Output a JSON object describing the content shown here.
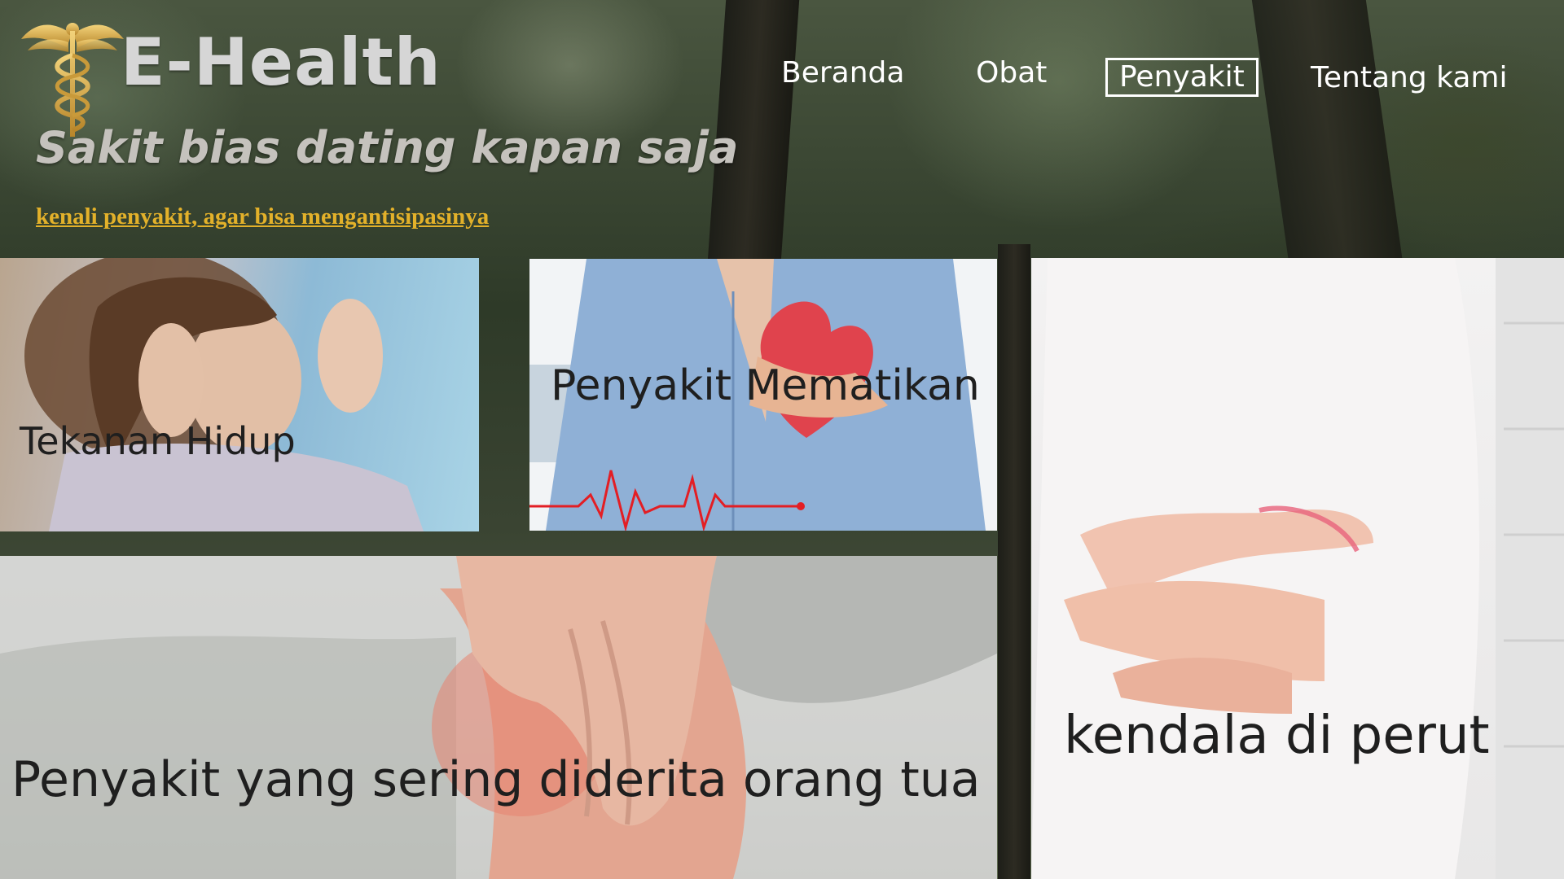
{
  "header": {
    "brand": "E-Health",
    "tagline": "Sakit bias dating kapan saja",
    "subtitle": "kenali penyakit, agar bisa mengantisipasinya"
  },
  "nav": {
    "items": [
      "Beranda",
      "Obat",
      "Penyakit",
      "Tentang kami"
    ],
    "active": "Penyakit"
  },
  "cards": {
    "tekanan": "Tekanan Hidup",
    "mematikan": "Penyakit Mematikan",
    "perut": "kendala di perut",
    "orang_tua": "Penyakit yang sering diderita orang tua"
  },
  "colors": {
    "accent_link": "#e3b12a",
    "nav_text": "#ffffff",
    "brand_text": "#d6d6d6"
  }
}
